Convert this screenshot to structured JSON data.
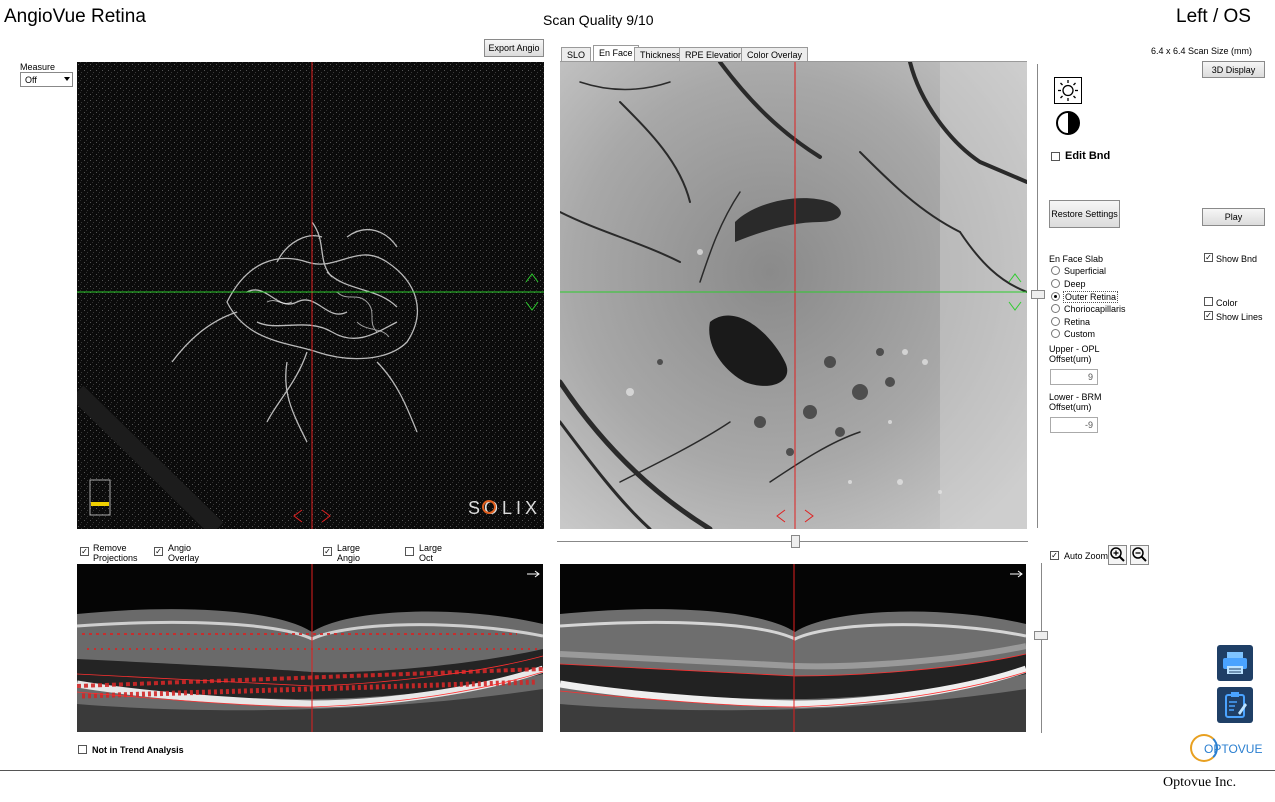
{
  "header": {
    "app_title": "AngioVue Retina",
    "scan_quality": "Scan Quality 9/10",
    "eye": "Left / OS"
  },
  "measure": {
    "label": "Measure",
    "value": "Off"
  },
  "export_button": "Export Angio",
  "tabs": [
    "SLO",
    "En Face",
    "Thickness",
    "RPE Elevation",
    "Color Overlay"
  ],
  "active_tab": "En Face",
  "scan_size": "6.4 x 6.4 Scan Size (mm)",
  "display_3d_button": "3D Display",
  "edit_bnd": "Edit Bnd",
  "restore_button": "Restore Settings",
  "play_button": "Play",
  "slab": {
    "title": "En Face Slab",
    "options": [
      "Superficial",
      "Deep",
      "Outer Retina",
      "Choriocapillaris",
      "Retina",
      "Custom"
    ],
    "selected": "Outer Retina",
    "upper_label_1": "Upper - OPL",
    "upper_label_2": "Offset(um)",
    "upper_value": "9",
    "lower_label_1": "Lower - BRM",
    "lower_label_2": "Offset(um)",
    "lower_value": "-9"
  },
  "right_options": {
    "show_bnd": "Show Bnd",
    "color": "Color",
    "show_lines": "Show Lines"
  },
  "bottom_checks": {
    "remove_1": "Remove",
    "remove_2": "Projections",
    "angio_1": "Angio",
    "angio_2": "Overlay",
    "large_angio_1": "Large",
    "large_angio_2": "Angio",
    "large_oct_1": "Large",
    "large_oct_2": "Oct"
  },
  "auto_zoom": "Auto Zoom",
  "not_in_trend": "Not in Trend Analysis",
  "solix_logo": "SOLIX",
  "optovue_logo": "OPTOVUE",
  "footer": "Optovue Inc.",
  "colors": {
    "red_line": "#e02020",
    "green_line": "#2ecc2e",
    "icon_blue": "#1f3f66"
  }
}
